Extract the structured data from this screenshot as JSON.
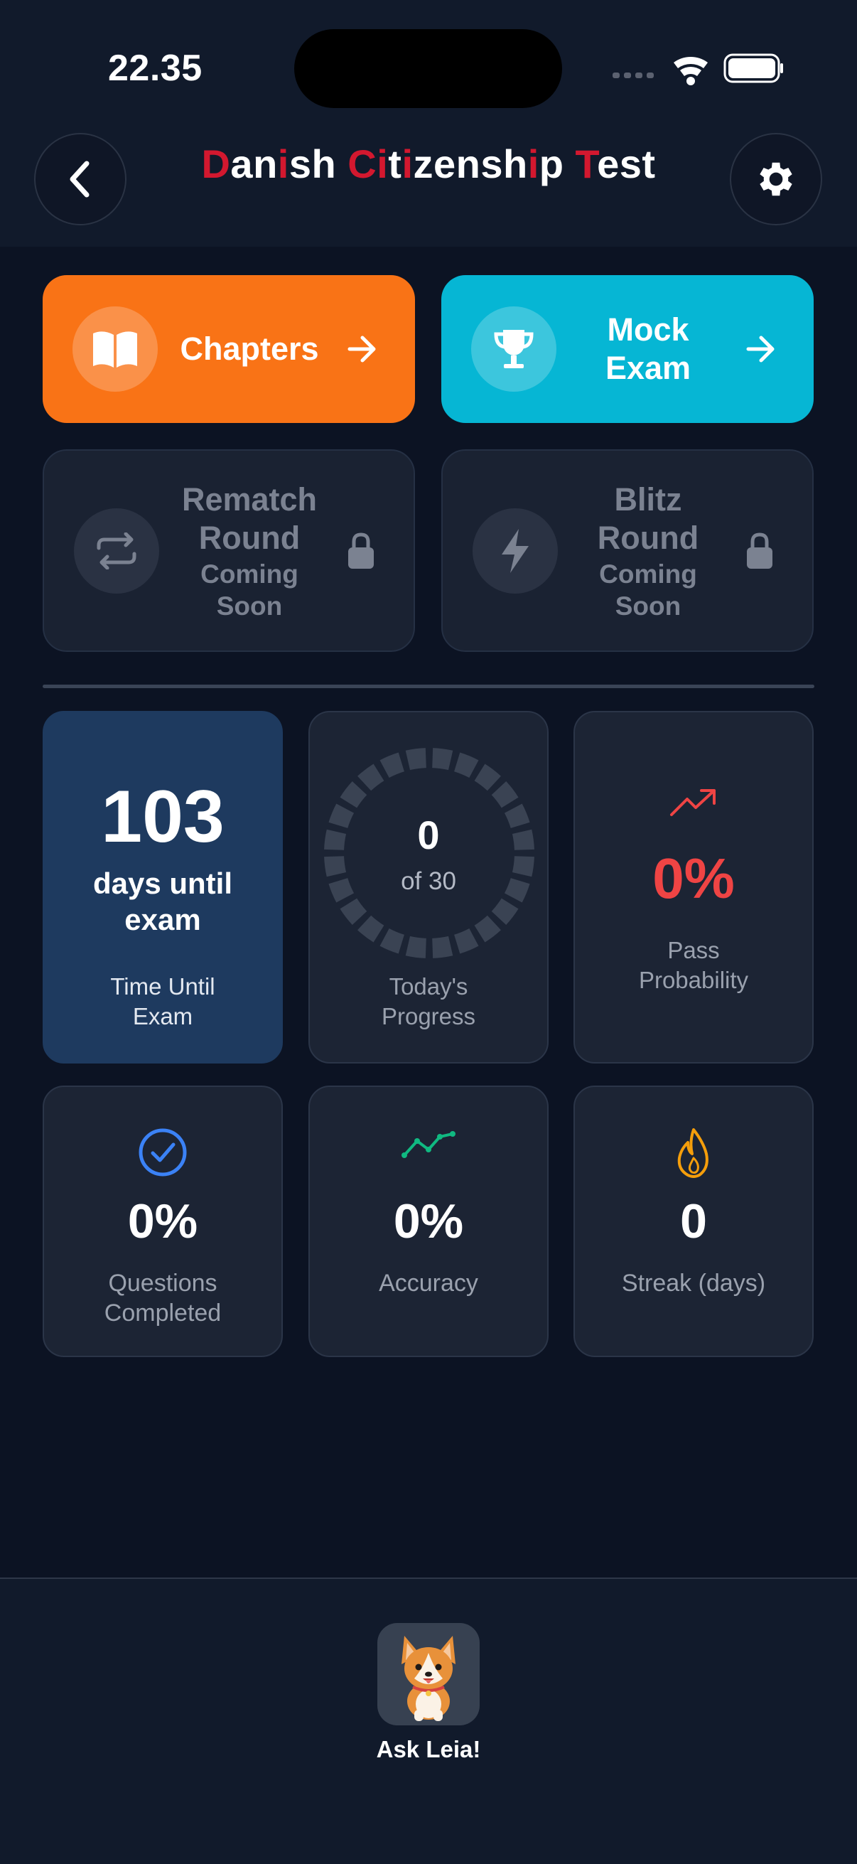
{
  "status_bar": {
    "time": "22.35"
  },
  "header": {
    "title_parts": [
      {
        "t": "D",
        "red": true
      },
      {
        "t": "an",
        "red": false
      },
      {
        "t": "i",
        "red": true
      },
      {
        "t": "sh ",
        "red": false
      },
      {
        "t": "C",
        "red": true
      },
      {
        "t": "i",
        "red": true
      },
      {
        "t": "t",
        "red": false
      },
      {
        "t": "i",
        "red": true
      },
      {
        "t": "zensh",
        "red": false
      },
      {
        "t": "i",
        "red": true
      },
      {
        "t": "p ",
        "red": false
      },
      {
        "t": "T",
        "red": true
      },
      {
        "t": "est",
        "red": false
      }
    ],
    "back_icon": "chevron-left-icon",
    "settings_icon": "gear-icon"
  },
  "actions": {
    "chapters": {
      "label": "Chapters",
      "icon": "book-icon",
      "color": "#f97316"
    },
    "mock_exam": {
      "label_line1": "Mock",
      "label_line2": "Exam",
      "icon": "trophy-icon",
      "color": "#06b6d4"
    },
    "rematch": {
      "line1": "Rematch",
      "line2": "Round",
      "status1": "Coming",
      "status2": "Soon",
      "icon": "repeat-icon"
    },
    "blitz": {
      "line1": "Blitz",
      "line2": "Round",
      "status1": "Coming",
      "status2": "Soon",
      "icon": "lightning-icon"
    }
  },
  "stats": {
    "days_until": {
      "value": "103",
      "sub1": "days until",
      "sub2": "exam",
      "cap1": "Time Until",
      "cap2": "Exam"
    },
    "today_progress": {
      "value": "0",
      "of_text": "of 30",
      "done": 0,
      "goal": 30,
      "cap1": "Today's",
      "cap2": "Progress"
    },
    "pass_probability": {
      "value": "0%",
      "cap1": "Pass",
      "cap2": "Probability",
      "color": "#ef4444"
    },
    "questions_completed": {
      "value": "0%",
      "cap1": "Questions",
      "cap2": "Completed"
    },
    "accuracy": {
      "value": "0%",
      "cap": "Accuracy"
    },
    "streak": {
      "value": "0",
      "cap": "Streak (days)"
    }
  },
  "bottom": {
    "assistant_label": "Ask Leia!"
  }
}
